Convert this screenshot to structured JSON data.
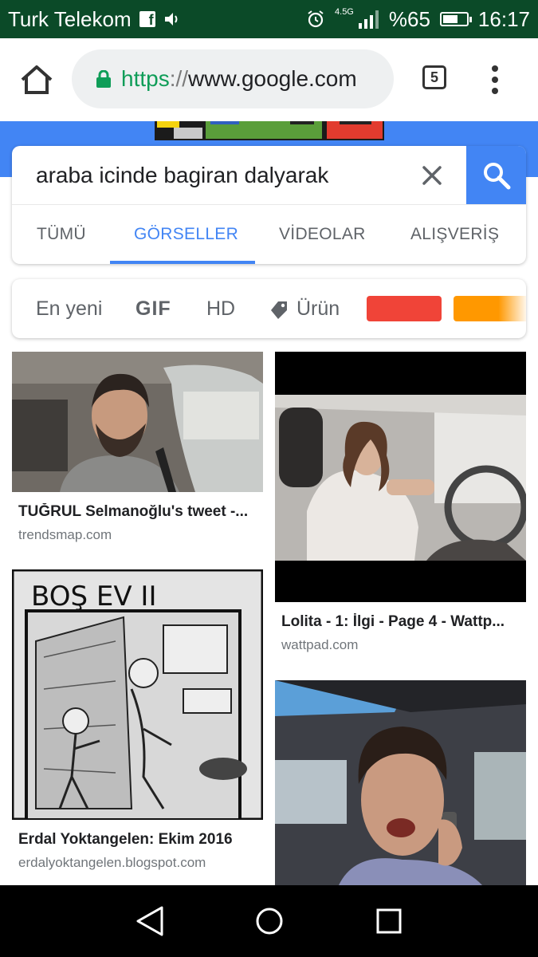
{
  "status_bar": {
    "carrier": "Turk Telekom",
    "network": "4.5G",
    "battery": "%65",
    "time": "16:17",
    "battery_level": 0.65
  },
  "browser": {
    "url_scheme": "https",
    "url_rest": "www.google.com",
    "tab_count": "5"
  },
  "search": {
    "query": "araba icinde bagiran dalyarak",
    "tabs": [
      {
        "label": "TÜMÜ",
        "active": false
      },
      {
        "label": "GÖRSELLER",
        "active": true
      },
      {
        "label": "VİDEOLAR",
        "active": false
      },
      {
        "label": "ALIŞVERİŞ",
        "active": false
      }
    ]
  },
  "filters": {
    "newest": "En yeni",
    "gif": "GIF",
    "hd": "HD",
    "product": "Ürün",
    "colors": [
      "#f04438",
      "#ff9800"
    ]
  },
  "results": [
    {
      "title": "TUĞRUL Selmanoğlu's tweet -...",
      "domain": "trendsmap.com"
    },
    {
      "title": "Lolita - 1: İlgi - Page 4 - Wattp...",
      "domain": "wattpad.com"
    },
    {
      "title": "Erdal Yoktangelen: Ekim 2016",
      "domain": "erdalyoktangelen.blogspot.com"
    },
    {
      "title": "",
      "domain": ""
    }
  ],
  "comic_text": "BOŞ EV II"
}
